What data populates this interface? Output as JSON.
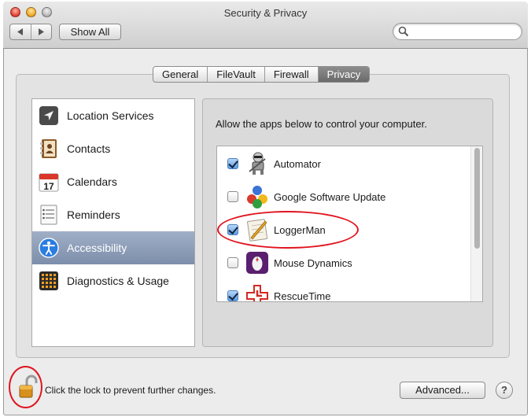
{
  "window": {
    "title": "Security & Privacy"
  },
  "toolbar": {
    "back_icon": "back-arrow-icon",
    "forward_icon": "forward-arrow-icon",
    "show_all_label": "Show All",
    "search_placeholder": "",
    "search_value": ""
  },
  "tabs": [
    {
      "label": "General",
      "active": false
    },
    {
      "label": "FileVault",
      "active": false
    },
    {
      "label": "Firewall",
      "active": false
    },
    {
      "label": "Privacy",
      "active": true
    }
  ],
  "sidebar": {
    "items": [
      {
        "label": "Location Services",
        "icon": "location-arrow-icon",
        "selected": false
      },
      {
        "label": "Contacts",
        "icon": "contacts-book-icon",
        "selected": false
      },
      {
        "label": "Calendars",
        "icon": "calendar-icon",
        "selected": false
      },
      {
        "label": "Reminders",
        "icon": "reminders-list-icon",
        "selected": false
      },
      {
        "label": "Accessibility",
        "icon": "accessibility-person-icon",
        "selected": true
      },
      {
        "label": "Diagnostics & Usage",
        "icon": "diagnostics-grid-icon",
        "selected": false
      }
    ]
  },
  "calendar_icon_day": "17",
  "main": {
    "allow_text": "Allow the apps below to control your computer.",
    "apps": [
      {
        "name": "Automator",
        "checked": true,
        "icon": "automator-robot-icon"
      },
      {
        "name": "Google Software Update",
        "checked": false,
        "icon": "google-balls-icon"
      },
      {
        "name": "LoggerMan",
        "checked": true,
        "icon": "loggerman-notepad-icon"
      },
      {
        "name": "Mouse Dynamics",
        "checked": false,
        "icon": "mouse-dynamics-icon"
      },
      {
        "name": "RescueTime",
        "checked": true,
        "icon": "rescuetime-clock-icon"
      }
    ]
  },
  "footer": {
    "lock_text": "Click the lock to prevent further changes.",
    "lock_icon": "unlocked-padlock-icon",
    "advanced_label": "Advanced...",
    "help_label": "?"
  },
  "colors": {
    "selection": "#7d8eab",
    "annotation_red": "#e0141e",
    "checkbox_blue": "#5b9cdf"
  }
}
